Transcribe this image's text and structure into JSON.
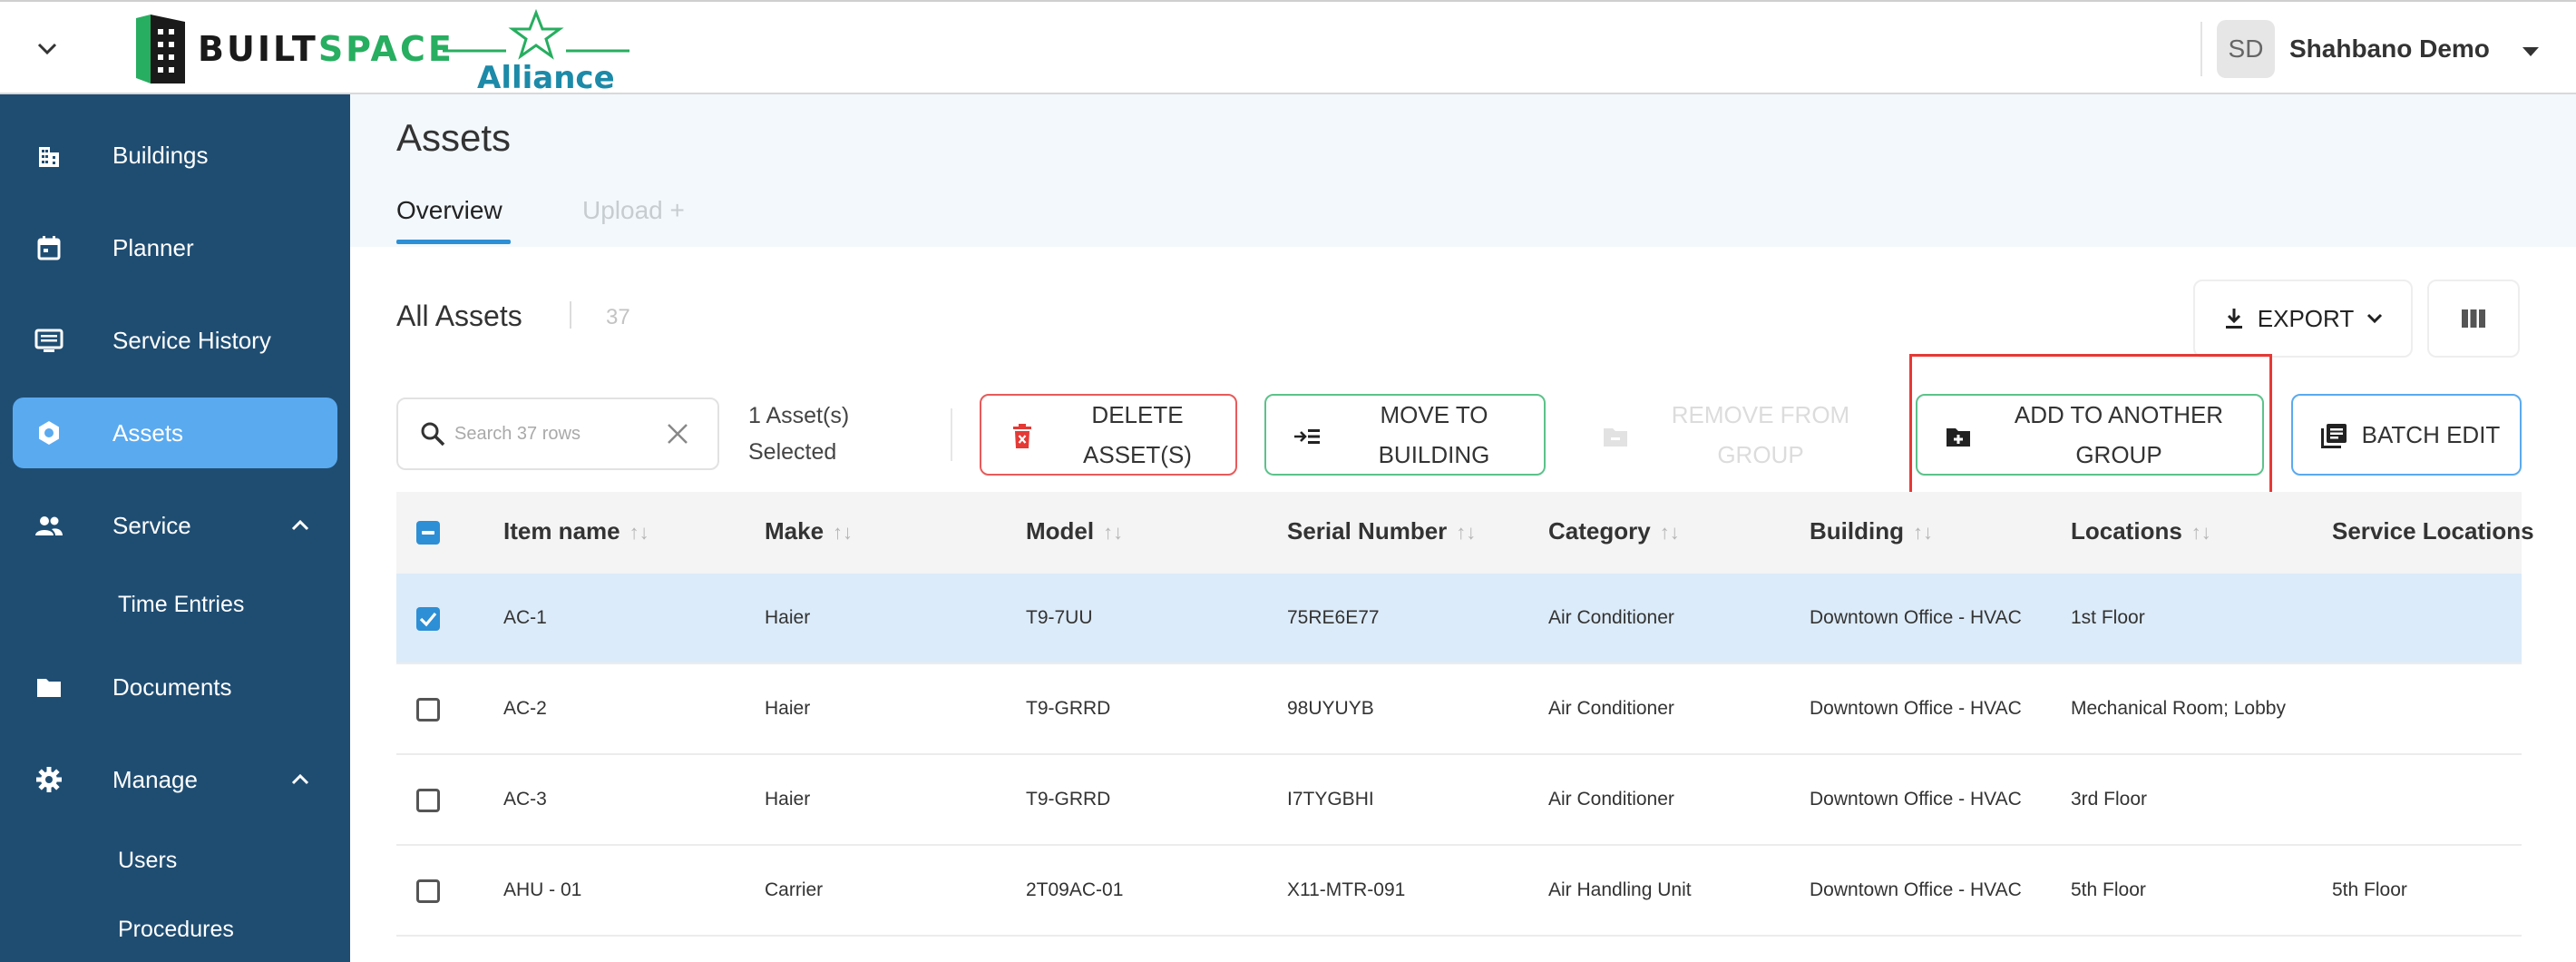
{
  "header": {
    "logo_part1": "BUILT",
    "logo_part2": "SPACE",
    "alliance": "Alliance",
    "user_initials": "SD",
    "user_name": "Shahbano Demo"
  },
  "sidebar": {
    "items": [
      {
        "label": "Buildings",
        "icon": "building-icon"
      },
      {
        "label": "Planner",
        "icon": "calendar-icon"
      },
      {
        "label": "Service History",
        "icon": "monitor-icon"
      },
      {
        "label": "Assets",
        "icon": "hexagon-icon"
      },
      {
        "label": "Service",
        "icon": "people-icon"
      },
      {
        "label": "Documents",
        "icon": "folder-icon"
      },
      {
        "label": "Manage",
        "icon": "gear-icon"
      }
    ],
    "sub_items": {
      "time_entries": "Time Entries",
      "users": "Users",
      "procedures": "Procedures"
    }
  },
  "page": {
    "title": "Assets",
    "tabs": [
      "Overview",
      "Upload +"
    ]
  },
  "section": {
    "title": "All Assets",
    "count": "37",
    "export_label": "EXPORT"
  },
  "toolbar": {
    "search_placeholder": "Search 37 rows",
    "selected_line1": "1 Asset(s)",
    "selected_line2": "Selected",
    "delete_line1": "DELETE",
    "delete_line2": "ASSET(S)",
    "move_line1": "MOVE TO",
    "move_line2": "BUILDING",
    "remove_line1": "REMOVE FROM",
    "remove_line2": "GROUP",
    "add_line1": "ADD TO ANOTHER",
    "add_line2": "GROUP",
    "batch_edit": "BATCH EDIT"
  },
  "table": {
    "columns": [
      "Item name",
      "Make",
      "Model",
      "Serial Number",
      "Category",
      "Building",
      "Locations",
      "Service Locations"
    ],
    "rows": [
      {
        "checked": true,
        "item": "AC-1",
        "make": "Haier",
        "model": "T9-7UU",
        "serial": "75RE6E77",
        "category": "Air Conditioner",
        "building": "Downtown Office - HVAC",
        "locations": "1st Floor",
        "service_locations": ""
      },
      {
        "checked": false,
        "item": "AC-2",
        "make": "Haier",
        "model": "T9-GRRD",
        "serial": "98UYUYB",
        "category": "Air Conditioner",
        "building": "Downtown Office - HVAC",
        "locations": "Mechanical Room; Lobby",
        "service_locations": ""
      },
      {
        "checked": false,
        "item": "AC-3",
        "make": "Haier",
        "model": "T9-GRRD",
        "serial": "I7TYGBHI",
        "category": "Air Conditioner",
        "building": "Downtown Office - HVAC",
        "locations": "3rd Floor",
        "service_locations": ""
      },
      {
        "checked": false,
        "item": "AHU - 01",
        "make": "Carrier",
        "model": "2T09AC-01",
        "serial": "X11-MTR-091",
        "category": "Air Handling Unit",
        "building": "Downtown Office - HVAC",
        "locations": "5th Floor",
        "service_locations": "5th Floor"
      }
    ]
  },
  "colors": {
    "sidebar_bg": "#1f4d72",
    "active_nav": "#5aaaf0",
    "accent_blue": "#2d8fd5",
    "accent_green": "#5cc28a",
    "danger_red": "#e85a5a"
  }
}
